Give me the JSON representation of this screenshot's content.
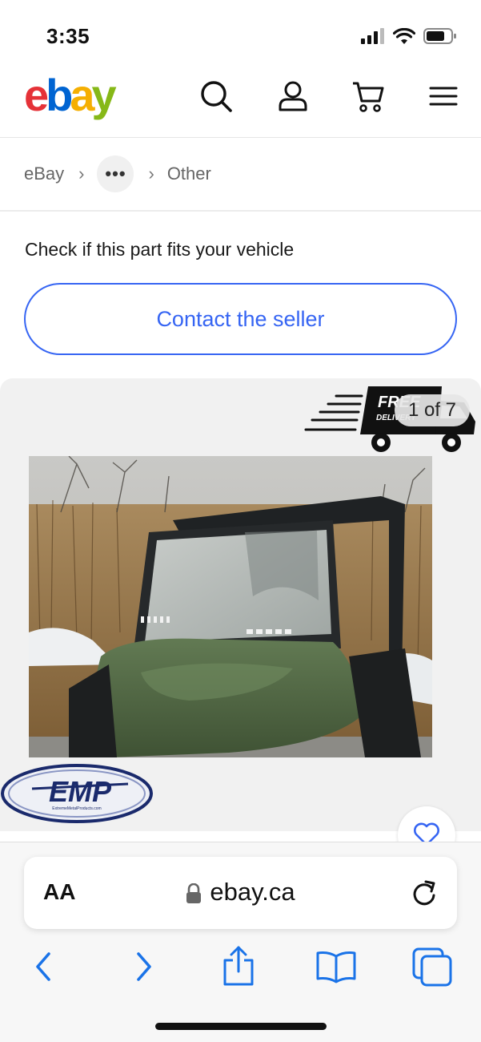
{
  "status_bar": {
    "time": "3:35"
  },
  "header": {
    "logo": {
      "e": "e",
      "b": "b",
      "a": "a",
      "y": "y"
    },
    "icons": [
      "search-icon",
      "account-icon",
      "cart-icon",
      "menu-icon"
    ]
  },
  "breadcrumb": {
    "home": "eBay",
    "more": "•••",
    "current": "Other"
  },
  "fitment": {
    "prompt": "Check if this part fits your vehicle",
    "button": "Contact the seller"
  },
  "gallery": {
    "counter": "1 of 7",
    "badge_title": "FREE",
    "badge_sub": "DELIVERY",
    "brand_logo": "EMP",
    "brand_sub": "ExtremeMetalProducts.com"
  },
  "safari": {
    "text_size": "AA",
    "url": "ebay.ca"
  },
  "colors": {
    "ebay_red": "#e53238",
    "ebay_blue": "#0064d2",
    "ebay_yellow": "#f5af02",
    "ebay_green": "#86b817",
    "link_blue": "#3665f3",
    "ios_blue": "#1a73e8"
  }
}
